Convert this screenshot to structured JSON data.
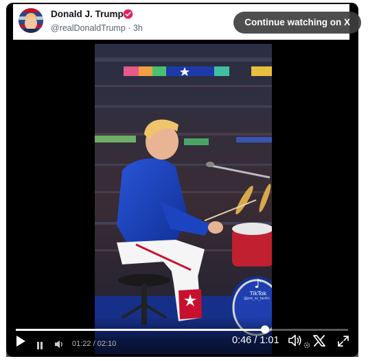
{
  "tweet": {
    "author_name": "Donald J. Trump",
    "handle": "@realDonaldTrump",
    "separator": "·",
    "time": "3h"
  },
  "cta_label": "Continue watching on X",
  "overlay": {
    "watermark_brand": "TikTok",
    "watermark_user": "@pro_sc_tanlin"
  },
  "embedded_player": {
    "time_label": "01:22 / 02:10"
  },
  "player": {
    "current_time": "0:46",
    "separator": "/",
    "duration": "1:01",
    "progress_fraction": 0.75
  },
  "icons": {
    "play": "play-icon",
    "pause": "pause-icon",
    "volume_small": "volume-icon",
    "volume": "volume-icon",
    "brand": "x-logo-icon",
    "fullscreen": "fullscreen-icon",
    "settings": "gear-icon",
    "verified": "verified-badge-icon"
  },
  "colors": {
    "verified": "#e0245e",
    "cta_bg": "#3f3f3f",
    "stage_blue": "#1a47c8"
  }
}
